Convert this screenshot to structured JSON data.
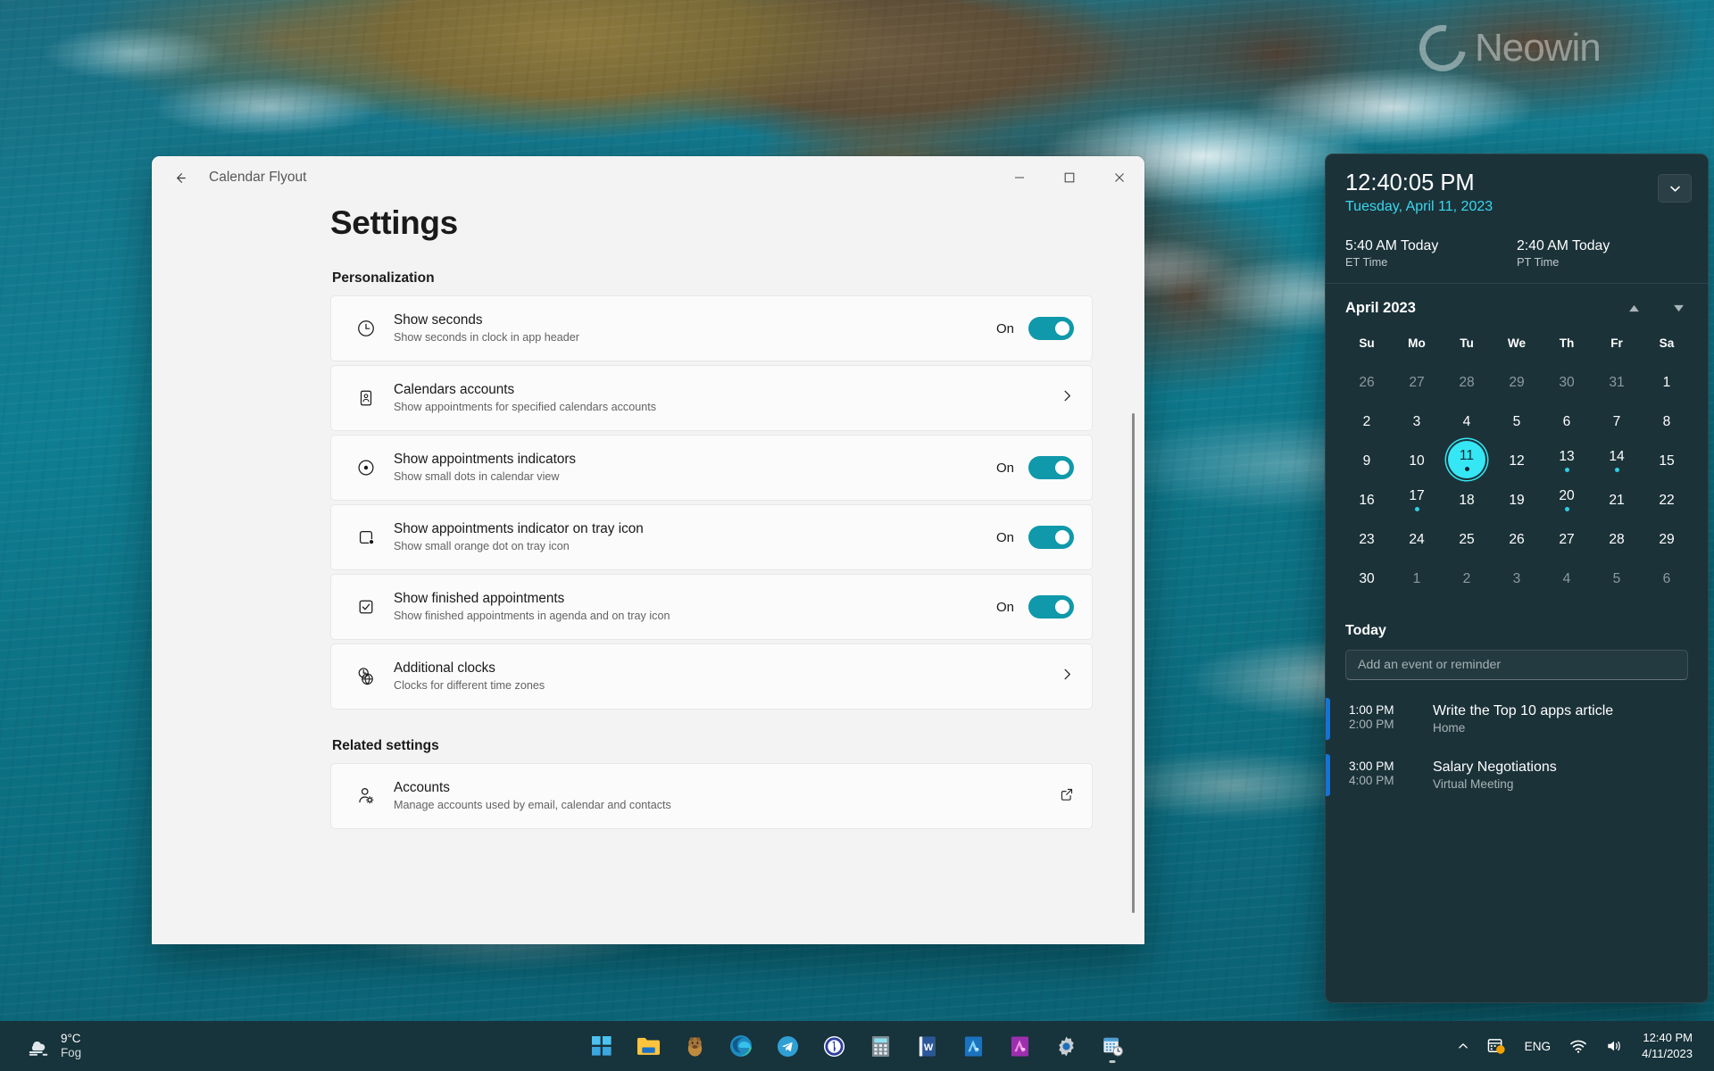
{
  "colors": {
    "accent_toggle": "#0f99aa",
    "flyout_bg": "#1b3239",
    "flyout_date": "#39d8ee",
    "today_highlight": "#35e6f5",
    "event_bar": "#1673d6",
    "taskbar_bg": "#17333b",
    "tray_dot": "#f2a104"
  },
  "watermark": {
    "text": "Neowin"
  },
  "window": {
    "title": "Calendar Flyout",
    "back_icon": "arrow-left-icon",
    "minimize_label": "—",
    "maximize_label": "□",
    "close_label": "✕",
    "page_title": "Settings"
  },
  "sections": [
    {
      "label": "Personalization",
      "rows": [
        {
          "icon": "clock-icon",
          "title": "Show seconds",
          "subtitle": "Show seconds in clock in app header",
          "control": "toggle",
          "state_label": "On"
        },
        {
          "icon": "contact-card-icon",
          "title": "Calendars accounts",
          "subtitle": "Show appointments for specified calendars accounts",
          "control": "chevron",
          "state_label": ""
        },
        {
          "icon": "dot-in-circle-icon",
          "title": "Show appointments indicators",
          "subtitle": "Show small dots in calendar view",
          "control": "toggle",
          "state_label": "On"
        },
        {
          "icon": "tray-icon-badge-icon",
          "title": "Show appointments indicator on tray icon",
          "subtitle": "Show small orange dot on tray icon",
          "control": "toggle",
          "state_label": "On"
        },
        {
          "icon": "checkbox-checked-icon",
          "title": "Show finished appointments",
          "subtitle": "Show finished appointments in agenda and on tray icon",
          "control": "toggle",
          "state_label": "On"
        },
        {
          "icon": "world-clock-icon",
          "title": "Additional clocks",
          "subtitle": "Clocks for different time zones",
          "control": "chevron",
          "state_label": ""
        }
      ]
    },
    {
      "label": "Related settings",
      "rows": [
        {
          "icon": "account-settings-icon",
          "title": "Accounts",
          "subtitle": "Manage accounts used by email, calendar and contacts",
          "control": "external",
          "state_label": ""
        }
      ]
    }
  ],
  "flyout": {
    "time": "12:40:05 PM",
    "date": "Tuesday, April 11, 2023",
    "expand_icon": "chevron-down-icon",
    "clocks": [
      {
        "time": "5:40 AM Today",
        "zone": "ET Time"
      },
      {
        "time": "2:40 AM Today",
        "zone": "PT Time"
      }
    ],
    "calendar": {
      "month_label": "April 2023",
      "prev_icon": "triangle-up-icon",
      "next_icon": "triangle-down-icon",
      "day_headers": [
        "Su",
        "Mo",
        "Tu",
        "We",
        "Th",
        "Fr",
        "Sa"
      ],
      "weeks": [
        [
          {
            "n": "26",
            "other": true
          },
          {
            "n": "27",
            "other": true
          },
          {
            "n": "28",
            "other": true
          },
          {
            "n": "29",
            "other": true
          },
          {
            "n": "30",
            "other": true
          },
          {
            "n": "31",
            "other": true
          },
          {
            "n": "1",
            "other": false
          }
        ],
        [
          {
            "n": "2"
          },
          {
            "n": "3"
          },
          {
            "n": "4"
          },
          {
            "n": "5"
          },
          {
            "n": "6"
          },
          {
            "n": "7"
          },
          {
            "n": "8"
          }
        ],
        [
          {
            "n": "9"
          },
          {
            "n": "10"
          },
          {
            "n": "11",
            "today": true,
            "dot": true
          },
          {
            "n": "12"
          },
          {
            "n": "13",
            "dot": true
          },
          {
            "n": "14",
            "dot": true
          },
          {
            "n": "15"
          }
        ],
        [
          {
            "n": "16"
          },
          {
            "n": "17",
            "dot": true
          },
          {
            "n": "18"
          },
          {
            "n": "19"
          },
          {
            "n": "20",
            "dot": true
          },
          {
            "n": "21"
          },
          {
            "n": "22"
          }
        ],
        [
          {
            "n": "23"
          },
          {
            "n": "24"
          },
          {
            "n": "25"
          },
          {
            "n": "26"
          },
          {
            "n": "27"
          },
          {
            "n": "28"
          },
          {
            "n": "29"
          }
        ],
        [
          {
            "n": "30"
          },
          {
            "n": "1",
            "other": true
          },
          {
            "n": "2",
            "other": true
          },
          {
            "n": "3",
            "other": true
          },
          {
            "n": "4",
            "other": true
          },
          {
            "n": "5",
            "other": true
          },
          {
            "n": "6",
            "other": true
          }
        ]
      ]
    },
    "agenda": {
      "title": "Today",
      "input_placeholder": "Add an event or reminder",
      "events": [
        {
          "start": "1:00 PM",
          "end": "2:00 PM",
          "title": "Write the Top 10 apps article",
          "subtitle": "Home"
        },
        {
          "start": "3:00 PM",
          "end": "4:00 PM",
          "title": "Salary Negotiations",
          "subtitle": "Virtual Meeting"
        }
      ]
    }
  },
  "taskbar": {
    "weather": {
      "temperature": "9°C",
      "condition": "Fog",
      "icon": "fog-cloud-icon"
    },
    "apps": [
      {
        "name": "start-button",
        "icon": "windows-logo-icon"
      },
      {
        "name": "file-explorer",
        "icon": "folder-icon"
      },
      {
        "name": "capybara-app",
        "icon": "capybara-icon"
      },
      {
        "name": "microsoft-edge",
        "icon": "edge-icon"
      },
      {
        "name": "telegram",
        "icon": "telegram-icon"
      },
      {
        "name": "1password",
        "icon": "1password-icon"
      },
      {
        "name": "calculator",
        "icon": "calculator-icon"
      },
      {
        "name": "microsoft-word",
        "icon": "word-icon"
      },
      {
        "name": "affinity-designer",
        "icon": "affinity-designer-icon"
      },
      {
        "name": "affinity-photo",
        "icon": "affinity-photo-icon"
      },
      {
        "name": "settings",
        "icon": "gear-icon"
      },
      {
        "name": "calendar-flyout-app",
        "icon": "calendar-clock-icon",
        "running": true
      }
    ],
    "tray": {
      "overflow_icon": "chevron-up-icon",
      "calendar_tray_icon": "calendar-tray-icon",
      "language": "ENG",
      "network_icon": "wifi-icon",
      "volume_icon": "speaker-icon",
      "clock_time": "12:40 PM",
      "clock_date": "4/11/2023"
    }
  }
}
